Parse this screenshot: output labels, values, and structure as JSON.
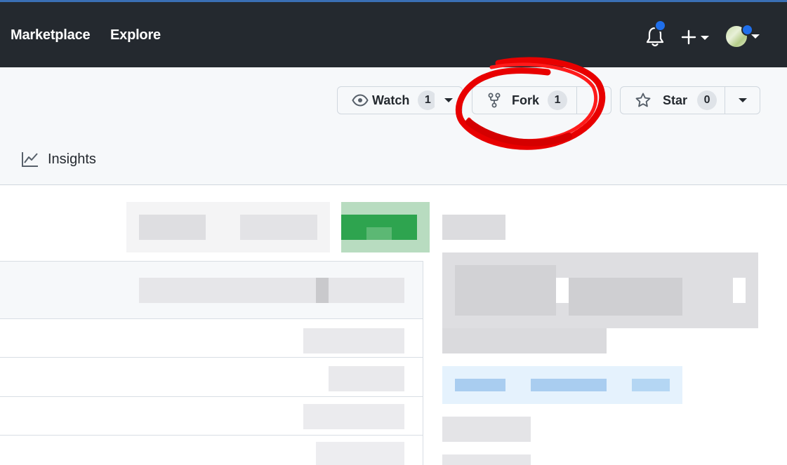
{
  "nav": {
    "items": [
      {
        "label": "Marketplace"
      },
      {
        "label": "Explore"
      }
    ],
    "icons": {
      "bell": "bell-icon",
      "plus": "plus-icon",
      "caret": "caret-down-icon",
      "avatar": "avatar"
    },
    "colors": {
      "bg": "#24292f",
      "accent_dot": "#1f6feb"
    }
  },
  "repo_actions": {
    "watch": {
      "label": "Watch",
      "count": "1",
      "icon": "eye-icon"
    },
    "fork": {
      "label": "Fork",
      "count": "1",
      "icon": "repo-forked-icon"
    },
    "star": {
      "label": "Star",
      "count": "0",
      "icon": "star-icon"
    }
  },
  "tabs": {
    "insights": {
      "label": "Insights",
      "icon": "graph-icon"
    }
  },
  "annotation": {
    "type": "red-circle",
    "target": "fork",
    "color": "#e00000"
  },
  "content": {
    "note": ""
  }
}
